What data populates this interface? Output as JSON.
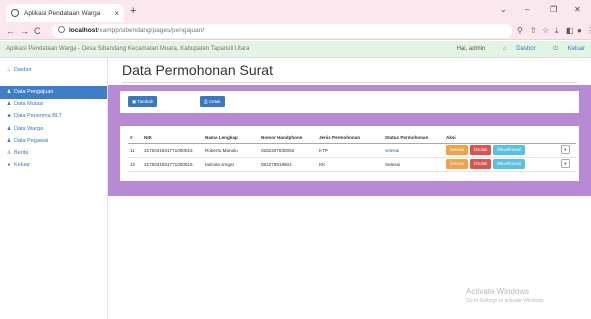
{
  "browser": {
    "tab_title": "Aplikasi Pendataan Warga",
    "tab_close": "×",
    "new_tab": "+",
    "url_host": "localhost",
    "url_path": "/xampp/sibendang/pages/pengajuan/",
    "window_controls": {
      "chevron": "⌄",
      "minimize": "–",
      "restore": "❐",
      "close": "✕"
    }
  },
  "app_header": {
    "title": "Aplikasi Pendataan Warga - Desa Sibandang Kecamatan Muara, Kabupaten Tapanuli Utara",
    "greeting": "Hai, admin",
    "dashboard_link": "Dasbor",
    "logout_link": "Keluar"
  },
  "sidebar": {
    "items": [
      {
        "label": "Dasbor",
        "icon": "home-icon",
        "glyph": "⌂"
      },
      {
        "label": "Data Pengajuan",
        "icon": "users-icon",
        "glyph": "♟",
        "active": true
      },
      {
        "label": "Data Mutasi",
        "icon": "users-icon",
        "glyph": "♟"
      },
      {
        "label": "Data Penerima BLT",
        "icon": "file-icon",
        "glyph": "■"
      },
      {
        "label": "Data Warga",
        "icon": "group-icon",
        "glyph": "♟"
      },
      {
        "label": "Data Pegawai",
        "icon": "group-icon",
        "glyph": "♟"
      },
      {
        "label": "Berita",
        "icon": "person-icon",
        "glyph": "♙"
      },
      {
        "label": "Keluar",
        "icon": "power-icon",
        "glyph": "●"
      }
    ]
  },
  "main": {
    "page_title": "Data Permohonan Surat",
    "toolbar": {
      "add_label": "Tambah",
      "print_label": "Cetak"
    },
    "table": {
      "headers": [
        "#",
        "NIK",
        "Nama Lengkap",
        "Nomor Handphone",
        "Jenis Permohonan",
        "Status Permohonan",
        "Aksi"
      ],
      "rows": [
        {
          "no": "11",
          "nik": "3175031501771000015",
          "nama": "Roberto Manalu",
          "hp": "0282207830052",
          "jenis": "KTP",
          "status": "selesai"
        },
        {
          "no": "12",
          "nik": "3175031501771000015",
          "nama": "Iasmita sregar",
          "hp": "082279819804",
          "jenis": "KK",
          "status": "Selesai"
        }
      ],
      "actions": {
        "finish": "Selesai",
        "reject": "Ditolak",
        "process": "Dikonfirmasi"
      }
    }
  },
  "os_watermark": {
    "line1": "Activate Windows",
    "line2": "Go to Settings to activate Windows."
  },
  "colors": {
    "accent": "#3f7dc9",
    "panel": "#b78ad3",
    "header": "#e3f4e5",
    "chrome": "#fbe7ee"
  }
}
